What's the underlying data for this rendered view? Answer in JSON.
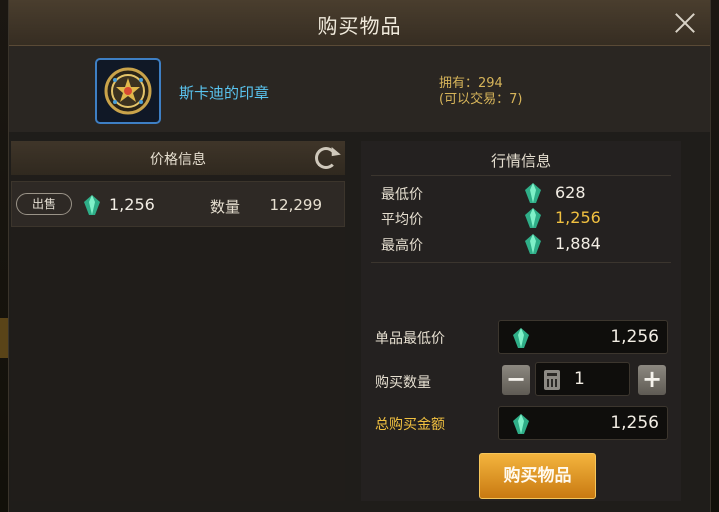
{
  "dialog": {
    "title": "购买物品"
  },
  "item": {
    "name": "斯卡迪的印章",
    "owned": "拥有：294",
    "tradable": "(可以交易：7)",
    "icon": "seal-medallion-icon"
  },
  "price_info": {
    "header": "价格信息",
    "listing": {
      "badge": "出售",
      "price": "1,256",
      "quantity_label": "数量",
      "quantity": "12,299"
    }
  },
  "market_info": {
    "header": "行情信息",
    "rows": [
      {
        "label": "最低价",
        "value": "628",
        "highlight": false
      },
      {
        "label": "平均价",
        "value": "1,256",
        "highlight": true
      },
      {
        "label": "最高价",
        "value": "1,884",
        "highlight": false
      }
    ]
  },
  "purchase_form": {
    "unit_min_price_label": "单品最低价",
    "unit_min_price": "1,256",
    "quantity_label": "购买数量",
    "quantity": "1",
    "decrement": "−",
    "increment": "+",
    "total_label": "总购买金额",
    "total": "1,256",
    "buy_button": "购买物品"
  },
  "colors": {
    "accent_gold": "#f0c040",
    "item_name_blue": "#5ac4ef",
    "gem_teal": "#3fd0a0",
    "buy_button": "#e09a24"
  }
}
